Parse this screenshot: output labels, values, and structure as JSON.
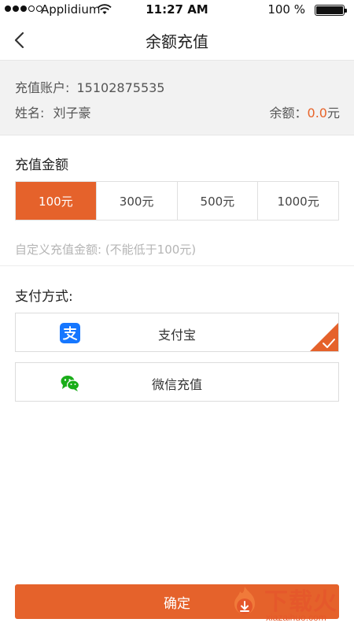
{
  "status_bar": {
    "carrier": "Applidium",
    "time": "11:27 AM",
    "battery": "100 %"
  },
  "nav": {
    "title": "余额充值"
  },
  "account": {
    "account_label": "充值账户:",
    "account_value": "15102875535",
    "name_label": "姓名:",
    "name_value": "刘子豪",
    "balance_label": "余额：",
    "balance_value": "0.0",
    "balance_unit": "元"
  },
  "recharge": {
    "section_title": "充值金额",
    "amounts": [
      "100元",
      "300元",
      "500元",
      "1000元"
    ],
    "selected_amount": "100元",
    "custom_placeholder": "自定义充值金额: (不能低于100元)"
  },
  "payment": {
    "section_title": "支付方式:",
    "methods": [
      {
        "label": "支付宝",
        "icon": "alipay-icon",
        "selected": true
      },
      {
        "label": "微信充值",
        "icon": "wechat-icon",
        "selected": false
      }
    ]
  },
  "confirm_label": "确定",
  "watermark": {
    "text": "下载火",
    "url": "xiazaihuo.com"
  },
  "colors": {
    "accent": "#e5622b",
    "alipay": "#1677ff",
    "wechat": "#1aad19",
    "section_bg": "#f2f2f2"
  }
}
